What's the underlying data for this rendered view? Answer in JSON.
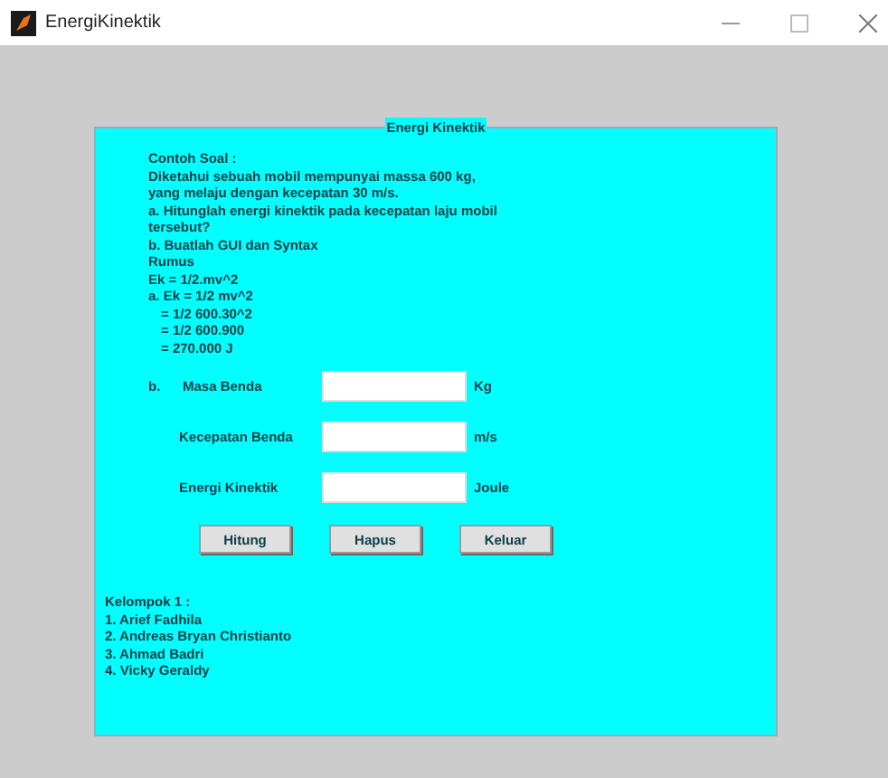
{
  "window": {
    "title": "EnergiKinektik"
  },
  "panel": {
    "title": "Energi Kinektik"
  },
  "problem_lines": [
    "Contoh Soal :",
    "Diketahui sebuah mobil mempunyai massa 600 kg,",
    "yang melaju dengan kecepatan 30 m/s.",
    "a. Hitunglah energi kinektik pada kecepatan laju mobil",
    "tersebut?",
    "b. Buatlah GUI dan Syntax",
    "Rumus",
    "Ek = 1/2.mv^2",
    "a. Ek = 1/2 mv^2"
  ],
  "solution_lines": [
    "= 1/2 600.30^2",
    "= 1/2 600.900",
    "= 270.000 J"
  ],
  "fields": [
    {
      "prefix": "b.",
      "label": "Masa Benda",
      "unit": "Kg"
    },
    {
      "label": "Kecepatan Benda",
      "unit": "m/s"
    },
    {
      "label": "Energi Kinektik",
      "unit": "Joule"
    }
  ],
  "buttons": [
    "Hitung",
    "Hapus",
    "Keluar"
  ],
  "group_lines": [
    "Kelompok 1 :",
    "1. Arief Fadhila",
    "2. Andreas Bryan Christianto",
    "3. Ahmad Badri",
    "4. Vicky Geraldy"
  ]
}
